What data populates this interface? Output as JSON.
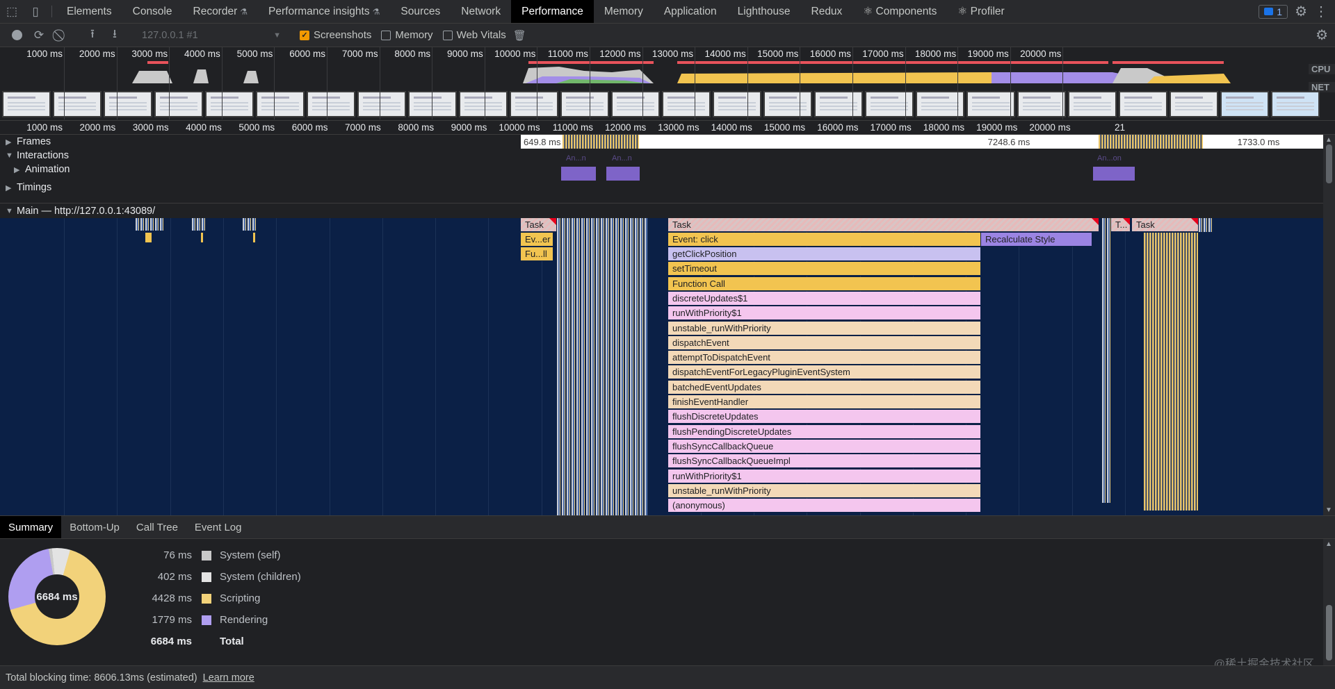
{
  "tabbar": {
    "tabs": [
      {
        "label": "Elements"
      },
      {
        "label": "Console"
      },
      {
        "label": "Recorder",
        "beaker": true
      },
      {
        "label": "Performance insights",
        "beaker": true
      },
      {
        "label": "Sources"
      },
      {
        "label": "Network"
      },
      {
        "label": "Performance",
        "active": true
      },
      {
        "label": "Memory"
      },
      {
        "label": "Application"
      },
      {
        "label": "Lighthouse"
      },
      {
        "label": "Redux"
      },
      {
        "label": "⚛ Components"
      },
      {
        "label": "⚛ Profiler"
      }
    ],
    "issues_count": "1"
  },
  "toolbar": {
    "profile_select": "127.0.0.1 #1",
    "screenshots_label": "Screenshots",
    "screenshots_checked": true,
    "memory_label": "Memory",
    "webvitals_label": "Web Vitals"
  },
  "overview": {
    "ticks": [
      "1000 ms",
      "2000 ms",
      "3000 ms",
      "4000 ms",
      "5000 ms",
      "6000 ms",
      "7000 ms",
      "8000 ms",
      "9000 ms",
      "10000 ms",
      "11000 ms",
      "12000 ms",
      "13000 ms",
      "14000 ms",
      "15000 ms",
      "16000 ms",
      "17000 ms",
      "18000 ms",
      "19000 ms",
      "20000 ms"
    ],
    "cpu_label": "CPU",
    "net_label": "NET"
  },
  "ruler": {
    "ticks": [
      "1000 ms",
      "2000 ms",
      "3000 ms",
      "4000 ms",
      "5000 ms",
      "6000 ms",
      "7000 ms",
      "8000 ms",
      "9000 ms",
      "10000 ms",
      "11000 ms",
      "12000 ms",
      "13000 ms",
      "14000 ms",
      "15000 ms",
      "16000 ms",
      "17000 ms",
      "18000 ms",
      "19000 ms",
      "20000 ms",
      "21"
    ]
  },
  "tracks": {
    "frames_label": "Frames",
    "interactions_label": "Interactions",
    "animation_label": "Animation",
    "timings_label": "Timings",
    "main_label": "Main — http://127.0.0.1:43089/",
    "frame_durations": [
      "649.8 ms",
      "7248.6 ms",
      "1733.0 ms"
    ],
    "animation_short": [
      "An...n",
      "An...n",
      "An...on"
    ]
  },
  "flame": {
    "task_label": "Task",
    "task_short": "T...",
    "ev_short": "Ev...er",
    "fu_short": "Fu...ll",
    "event_click": "Event: click",
    "recalc_style": "Recalculate Style",
    "stack": [
      "getClickPosition",
      "setTimeout",
      "Function Call",
      "discreteUpdates$1",
      "runWithPriority$1",
      "unstable_runWithPriority",
      "dispatchEvent",
      "attemptToDispatchEvent",
      "dispatchEventForLegacyPluginEventSystem",
      "batchedEventUpdates",
      "finishEventHandler",
      "flushDiscreteUpdates",
      "flushPendingDiscreteUpdates",
      "flushSyncCallbackQueue",
      "flushSyncCallbackQueueImpl",
      "runWithPriority$1",
      "unstable_runWithPriority",
      "(anonymous)"
    ]
  },
  "bottom_tabs": [
    "Summary",
    "Bottom-Up",
    "Call Tree",
    "Event Log"
  ],
  "summary": {
    "total_center": "6684 ms",
    "rows": [
      {
        "value": "76 ms",
        "label": "System (self)",
        "color": "#c9c9c9"
      },
      {
        "value": "402 ms",
        "label": "System (children)",
        "color": "#e3e3e3"
      },
      {
        "value": "4428 ms",
        "label": "Scripting",
        "color": "#f2d27a"
      },
      {
        "value": "1779 ms",
        "label": "Rendering",
        "color": "#af9ef0"
      }
    ],
    "total_value": "6684 ms",
    "total_label": "Total"
  },
  "status": {
    "text": "Total blocking time: 8606.13ms (estimated)",
    "learn_more": "Learn more"
  },
  "watermark": "@稀土掘金技术社区"
}
